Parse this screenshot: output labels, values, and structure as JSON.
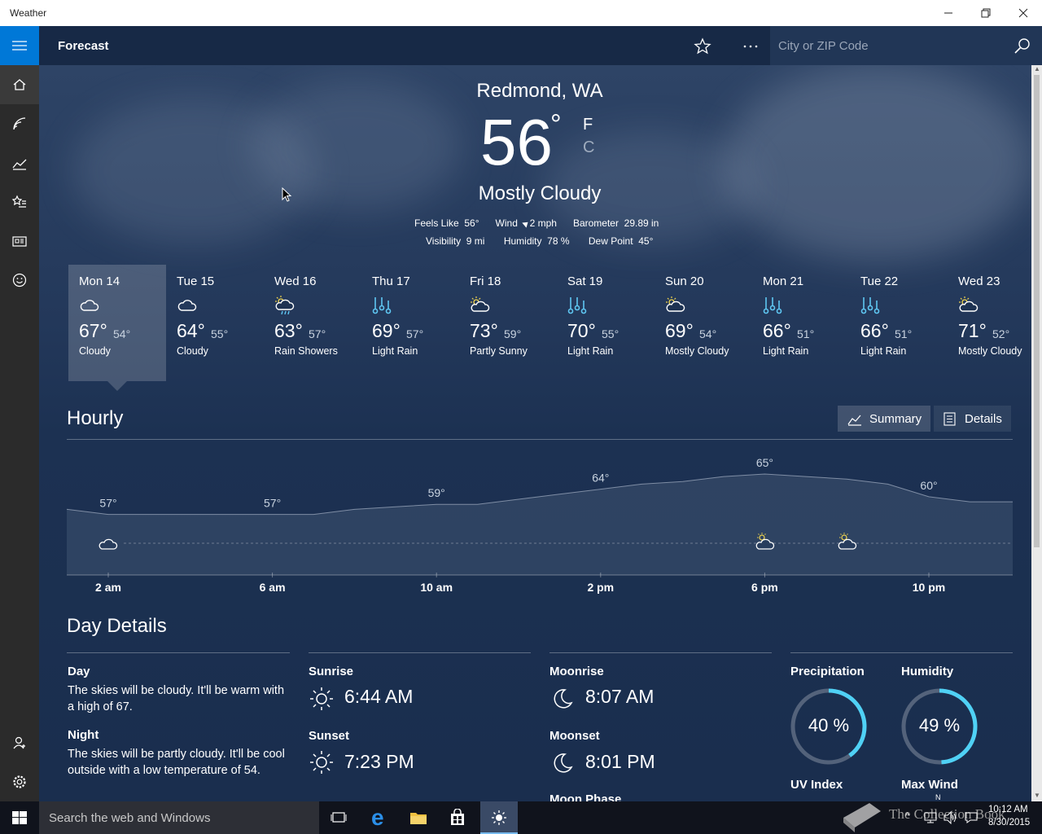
{
  "app": {
    "title": "Weather",
    "page": "Forecast"
  },
  "search": {
    "placeholder": "City or ZIP Code"
  },
  "current": {
    "location": "Redmond, WA",
    "temperature": "56",
    "degree": "°",
    "unit_f": "F",
    "unit_c": "C",
    "condition": "Mostly Cloudy",
    "details": {
      "feels_like_label": "Feels Like",
      "feels_like": "56°",
      "wind_label": "Wind",
      "wind": "2 mph",
      "barometer_label": "Barometer",
      "barometer": "29.89 in",
      "visibility_label": "Visibility",
      "visibility": "9 mi",
      "humidity_label": "Humidity",
      "humidity": "78 %",
      "dew_point_label": "Dew Point",
      "dew_point": "45°"
    }
  },
  "forecast": [
    {
      "day": "Mon 14",
      "hi": "67°",
      "lo": "54°",
      "cond": "Cloudy",
      "icon": "cloudy-icon"
    },
    {
      "day": "Tue 15",
      "hi": "64°",
      "lo": "55°",
      "cond": "Cloudy",
      "icon": "cloudy-icon"
    },
    {
      "day": "Wed 16",
      "hi": "63°",
      "lo": "57°",
      "cond": "Rain Showers",
      "icon": "rain-showers-icon"
    },
    {
      "day": "Thu 17",
      "hi": "69°",
      "lo": "57°",
      "cond": "Light Rain",
      "icon": "light-rain-icon"
    },
    {
      "day": "Fri 18",
      "hi": "73°",
      "lo": "59°",
      "cond": "Partly Sunny",
      "icon": "partly-sunny-icon"
    },
    {
      "day": "Sat 19",
      "hi": "70°",
      "lo": "55°",
      "cond": "Light Rain",
      "icon": "light-rain-icon"
    },
    {
      "day": "Sun 20",
      "hi": "69°",
      "lo": "54°",
      "cond": "Mostly Cloudy",
      "icon": "mostly-cloudy-icon"
    },
    {
      "day": "Mon 21",
      "hi": "66°",
      "lo": "51°",
      "cond": "Light Rain",
      "icon": "light-rain-icon"
    },
    {
      "day": "Tue 22",
      "hi": "66°",
      "lo": "51°",
      "cond": "Light Rain",
      "icon": "light-rain-icon"
    },
    {
      "day": "Wed 23",
      "hi": "71°",
      "lo": "52°",
      "cond": "Mostly Cloudy",
      "icon": "mostly-cloudy-icon"
    }
  ],
  "hourly": {
    "title": "Hourly",
    "summary_label": "Summary",
    "details_label": "Details",
    "time_labels": [
      "2 am",
      "6 am",
      "10 am",
      "2 pm",
      "6 pm",
      "10 pm"
    ],
    "temp_labels": [
      {
        "hour": 2,
        "label": "57°"
      },
      {
        "hour": 6,
        "label": "57°"
      },
      {
        "hour": 10,
        "label": "59°"
      },
      {
        "hour": 14,
        "label": "64°"
      },
      {
        "hour": 18,
        "label": "65°"
      },
      {
        "hour": 22,
        "label": "60°"
      }
    ]
  },
  "chart_data": {
    "type": "area",
    "title": "",
    "xlabel": "",
    "ylabel": "",
    "x": [
      1,
      2,
      3,
      4,
      5,
      6,
      7,
      8,
      9,
      10,
      11,
      12,
      13,
      14,
      15,
      16,
      17,
      18,
      19,
      20,
      21,
      22,
      23
    ],
    "x_tick_labels": [
      "2 am",
      "6 am",
      "10 am",
      "2 pm",
      "6 pm",
      "10 pm"
    ],
    "series": [
      {
        "values": [
          58,
          57,
          57,
          57,
          57,
          57,
          57,
          58,
          58.5,
          59,
          59,
          60,
          61,
          62,
          63,
          63.5,
          64.5,
          65,
          64.5,
          64,
          63,
          60.5,
          59.5
        ]
      }
    ],
    "ylim": [
      45,
      70
    ]
  },
  "day_details": {
    "title": "Day Details",
    "day_label": "Day",
    "day_text": "The skies will be cloudy. It'll be warm with a high of 67.",
    "night_label": "Night",
    "night_text": "The skies will be partly cloudy. It'll be cool outside with a low temperature of 54.",
    "sunrise_label": "Sunrise",
    "sunrise": "6:44 AM",
    "sunset_label": "Sunset",
    "sunset": "7:23 PM",
    "moonrise_label": "Moonrise",
    "moonrise": "8:07 AM",
    "moonset_label": "Moonset",
    "moonset": "8:01 PM",
    "moon_phase_label": "Moon Phase",
    "precip_label": "Precipitation",
    "precip": "40 %",
    "precip_value": 0.4,
    "humidity_label": "Humidity",
    "humidity": "49 %",
    "humidity_value": 0.49,
    "uv_label": "UV Index",
    "max_wind_label": "Max Wind",
    "max_wind_dir": "N"
  },
  "taskbar": {
    "search_placeholder": "Search the web and Windows",
    "time": "10:12 AM",
    "date": "8/30/2015",
    "watermark": "The Collection Book"
  },
  "colors": {
    "accent": "#0078d7",
    "gauge": "#4fd1f5",
    "rail": "#2b2b2b",
    "topbar": "#172946"
  }
}
